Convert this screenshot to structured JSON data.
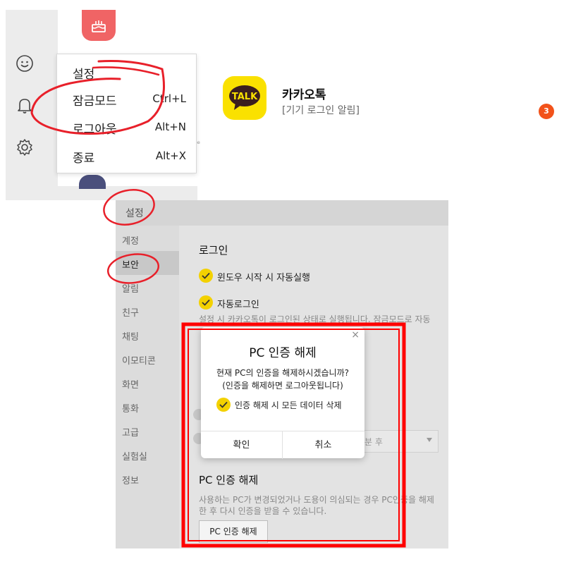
{
  "context_menu": {
    "items": [
      {
        "label": "설정",
        "shortcut": ""
      },
      {
        "label": "잠금모드",
        "shortcut": "Ctrl+L"
      },
      {
        "label": "로그아웃",
        "shortcut": "Alt+N"
      },
      {
        "label": "종료",
        "shortcut": "Alt+X"
      }
    ]
  },
  "side_rail": {
    "icons": [
      "smiley-icon",
      "bell-icon",
      "gear-icon"
    ]
  },
  "notification": {
    "app_name": "카카오톡",
    "logo_text": "TALK",
    "subtitle": "[기기 로그인 알림]",
    "badge_count": "3"
  },
  "settings": {
    "title": "설정",
    "sidebar": [
      "계정",
      "보안",
      "알림",
      "친구",
      "채팅",
      "이모티콘",
      "화면",
      "통화",
      "고급",
      "실험실",
      "정보"
    ],
    "active_item": "보안",
    "login_section": {
      "heading": "로그인",
      "options": [
        "윈도우 시작 시 자동실행",
        "자동로그인"
      ],
      "description": "설정 시 카카오톡이 로그인된 상태로 실행됩니다. 잠금모드로 자동"
    },
    "lock_dropdown_partial": "분 후",
    "pc_auth_section": {
      "heading": "PC 인증 해제",
      "description": "사용하는 PC가 변경되었거나 도용이 의심되는 경우 PC인증을 해제한 후 다시 인증을 받을 수 있습니다.",
      "button_label": "PC 인증 해제"
    }
  },
  "dialog": {
    "title": "PC 인증 해제",
    "message_line1": "현재 PC의 인증을 해제하시겠습니까?",
    "message_line2": "(인증을 해제하면 로그아웃됩니다)",
    "checkbox_label": "인증 해제 시 모든 데이터 삭제",
    "confirm_label": "확인",
    "cancel_label": "취소",
    "close_glyph": "×"
  },
  "colors": {
    "kakao_yellow": "#fae100",
    "check_yellow": "#f3d100",
    "badge_orange": "#f2521a",
    "annotation_red": "#e8202a",
    "highlight_box_red": "#ff0000"
  }
}
